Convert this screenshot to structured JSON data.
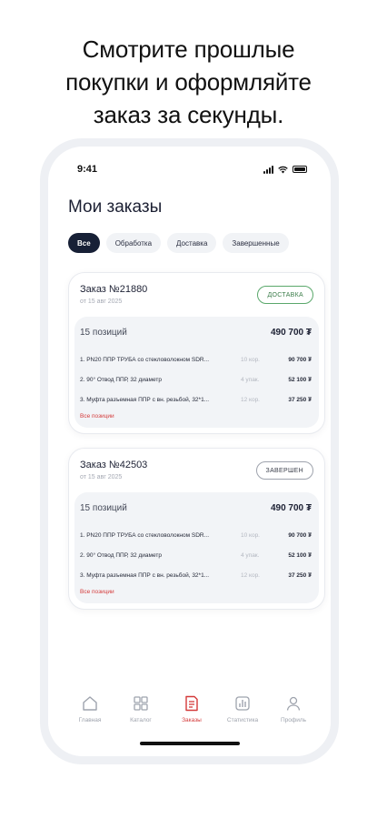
{
  "promo": {
    "line1": "Смотрите прошлые",
    "line2": "покупки и оформляйте",
    "line3": "заказ за секунды."
  },
  "status_bar": {
    "time": "9:41"
  },
  "page_title": "Мои заказы",
  "filters": [
    "Все",
    "Обработка",
    "Доставка",
    "Завершенные"
  ],
  "orders": [
    {
      "number": "Заказ №21880",
      "date": "от 15 авг 2025",
      "status": "ДОСТАВКА",
      "positions": "15 позиций",
      "total": "490 700 ₮",
      "items": [
        {
          "name": "1. PN20 ППР ТРУБА со стекловолокном SDR...",
          "qty": "10 кор.",
          "price": "90 700 ₮"
        },
        {
          "name": "2. 90° Отвод ППР, 32 диаметр",
          "qty": "4 упак.",
          "price": "52 100 ₮"
        },
        {
          "name": "3. Муфта разъемная ППР с вн. резьбой, 32*1...",
          "qty": "12 кор.",
          "price": "37 250 ₮"
        }
      ],
      "all_link": "Все позиции"
    },
    {
      "number": "Заказ №42503",
      "date": "от 15 авг 2025",
      "status": "ЗАВЕРШЕН",
      "positions": "15 позиций",
      "total": "490 700 ₮",
      "items": [
        {
          "name": "1. PN20 ППР ТРУБА со стекловолокном SDR...",
          "qty": "10 кор.",
          "price": "90 700 ₮"
        },
        {
          "name": "2. 90° Отвод ППР, 32 диаметр",
          "qty": "4 упак.",
          "price": "52 100 ₮"
        },
        {
          "name": "3. Муфта разъемная ППР с вн. резьбой, 32*1...",
          "qty": "12 кор.",
          "price": "37 250 ₮"
        }
      ],
      "all_link": "Все позиции"
    }
  ],
  "tabbar": [
    {
      "label": "Главная",
      "icon": "home-icon"
    },
    {
      "label": "Каталог",
      "icon": "catalog-icon"
    },
    {
      "label": "Заказы",
      "icon": "orders-icon",
      "active": true
    },
    {
      "label": "Статистика",
      "icon": "stats-icon"
    },
    {
      "label": "Профиль",
      "icon": "profile-icon"
    }
  ],
  "colors": {
    "accent": "#d43a3a",
    "active_chip": "#172036",
    "delivery_badge": "#5aa86b"
  }
}
